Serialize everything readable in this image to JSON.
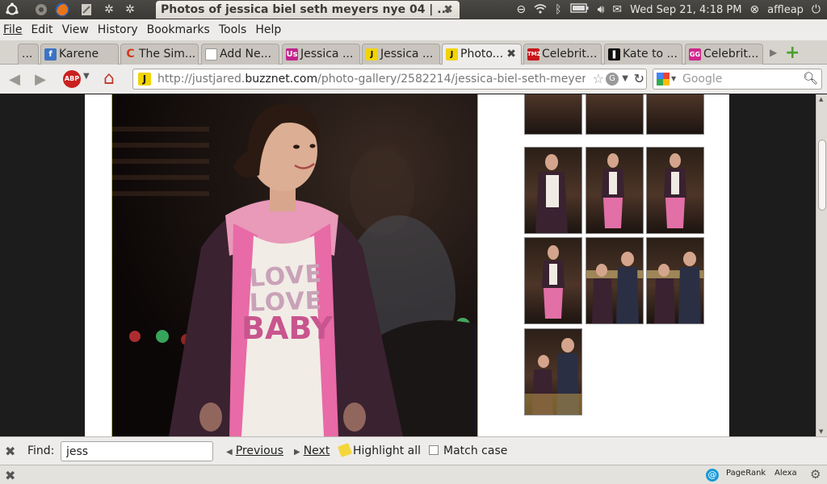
{
  "window": {
    "title": "Photos of jessica biel seth meyers nye 04 | ...",
    "close_glyph": "✖"
  },
  "panel": {
    "datetime": "Wed Sep 21,  4:18 PM",
    "username": "affleap"
  },
  "menu": {
    "file": "File",
    "edit": "Edit",
    "view": "View",
    "history": "History",
    "bookmarks": "Bookmarks",
    "tools": "Tools",
    "help": "Help"
  },
  "tabs": {
    "overflow": "...",
    "t1": "Karene",
    "t2": "The Sim...",
    "t3": "Add Ne...",
    "t4": "Jessica ...",
    "t5": "Jessica ...",
    "t6": "Photo...",
    "t7": "Celebrit...",
    "t8": "Kate to ...",
    "t9": "Celebrit...",
    "fav_tmz": "TMZ",
    "fav_j": "J",
    "fav_us": "Us",
    "fav_gg": "GG"
  },
  "nav": {
    "abp_label": "ABP",
    "url_prefix": "http://justjared.",
    "url_domain": "buzznet.com",
    "url_path": "/photo-gallery/2582214/jessica-biel-seth-meyers-nye",
    "search_placeholder": "Google"
  },
  "page": {
    "shirt_line1": "LOVE",
    "shirt_line2": "LOVE",
    "shirt_line3": "BABY"
  },
  "findbar": {
    "label": "Find:",
    "query": "jess",
    "previous": "Previous",
    "next": "Next",
    "highlight_all": "Highlight all",
    "match_case": "Match case"
  },
  "statusbar": {
    "pagerank": "PageRank",
    "alexa": "Alexa"
  },
  "colors": {
    "accent_pink": "#e86aa6",
    "thumb_border": "#888888",
    "photo_border": "#b7c13c"
  }
}
